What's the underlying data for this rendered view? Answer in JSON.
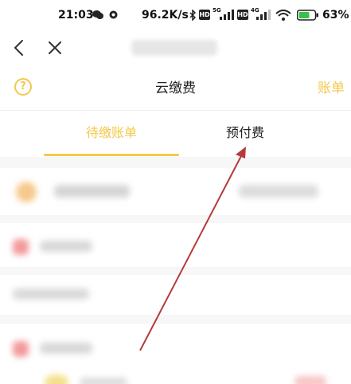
{
  "status_bar": {
    "time": "21:03",
    "net_speed": "96.2K/s",
    "hd1": "HD",
    "sig1": "5G",
    "hd2": "HD",
    "sig2": "4G",
    "battery_pct": "63%"
  },
  "header": {
    "title": "云缴费",
    "bill_link": "账单",
    "help_icon": "?"
  },
  "tabs": {
    "pending": "待缴账单",
    "prepaid": "预付费",
    "active": "pending"
  },
  "colors": {
    "accent": "#f2c94c",
    "annotation_arrow": "#b53a3a"
  }
}
